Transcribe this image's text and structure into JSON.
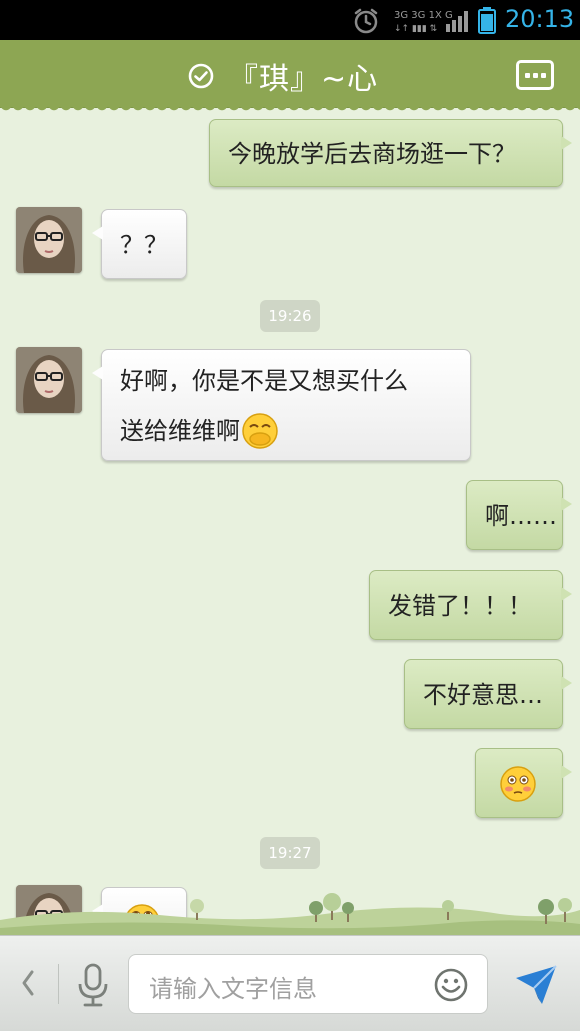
{
  "status_bar": {
    "time": "20:13",
    "network_label": "3G 3G 1X G"
  },
  "header": {
    "title": "『琪』~心",
    "verified_icon": "check-circle-icon",
    "menu_icon": "more-dots-icon"
  },
  "messages": [
    {
      "side": "out",
      "text": "今晚放学后去商场逛一下？"
    },
    {
      "side": "in",
      "text": "？？"
    },
    {
      "type": "time",
      "text": "19:26"
    },
    {
      "side": "in",
      "text_line1": "好啊，你是不是又想买什么",
      "text_line2": "送给维维啊",
      "emoji": "shy-hand-over-mouth-emoji"
    },
    {
      "side": "out",
      "text": "啊……"
    },
    {
      "side": "out",
      "text": "发错了！！！"
    },
    {
      "side": "out",
      "text": "不好意思…"
    },
    {
      "side": "out",
      "emoji": "embarrassed-sweat-emoji"
    },
    {
      "type": "time",
      "text": "19:27"
    },
    {
      "side": "in",
      "emoji": "rolling-eyes-emoji"
    }
  ],
  "input_bar": {
    "placeholder": "请输入文字信息",
    "icons": [
      "back-chevron-icon",
      "microphone-icon",
      "emoji-smile-icon",
      "send-icon"
    ]
  },
  "colors": {
    "title_bar": "#8da653",
    "chat_background": "#e8f1de",
    "outgoing_bubble": "#cfe2b2",
    "incoming_bubble": "#ffffff",
    "status_accent": "#35b4e8",
    "send_icon": "#2a7fd4"
  }
}
